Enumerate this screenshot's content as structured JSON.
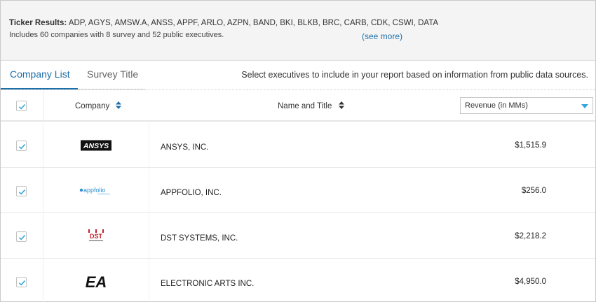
{
  "summary": {
    "ticker_label": "Ticker Results:",
    "tickers": "ADP, AGYS, AMSW.A, ANSS, APPF, ARLO, AZPN, BAND, BKI, BLKB, BRC, CARB, CDK, CSWI, DATA",
    "includes": "Includes 60 companies with 8 survey and 52 public executives.",
    "see_more": "(see more)"
  },
  "tabs": [
    {
      "label": "Company List",
      "active": true
    },
    {
      "label": "Survey Title",
      "active": false
    }
  ],
  "tabs_hint": "Select executives to include in your report based on information from public data sources.",
  "table": {
    "header": {
      "company": "Company",
      "name_title": "Name and Title",
      "metric_select": "Revenue (in MMs)"
    },
    "rows": [
      {
        "company": "ANSYS, INC.",
        "revenue": "$1,515.9",
        "checked": true,
        "logo_text": "ANSYS",
        "logo_icon": "ansys-logo"
      },
      {
        "company": "APPFOLIO, INC.",
        "revenue": "$256.0",
        "checked": true,
        "logo_text": "appfolio",
        "logo_icon": "appfolio-logo"
      },
      {
        "company": "DST SYSTEMS, INC.",
        "revenue": "$2,218.2",
        "checked": true,
        "logo_text": "DST",
        "logo_icon": "dst-logo"
      },
      {
        "company": "ELECTRONIC ARTS INC.",
        "revenue": "$4,950.0",
        "checked": true,
        "logo_text": "EA",
        "logo_icon": "ea-logo"
      }
    ]
  },
  "colors": {
    "accent": "#1e6ea8",
    "check": "#33a4dc",
    "caret": "#33a4dc",
    "summary_bg": "#f4f4f4"
  }
}
